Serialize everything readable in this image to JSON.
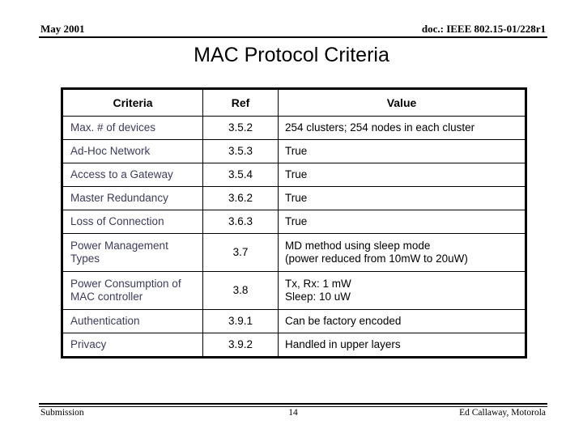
{
  "header": {
    "left": "May 2001",
    "right": "doc.: IEEE 802.15-01/228r1"
  },
  "title": "MAC Protocol Criteria",
  "table": {
    "columns": [
      "Criteria",
      "Ref",
      "Value"
    ],
    "rows": [
      {
        "criteria": "Max. # of devices",
        "ref": "3.5.2",
        "value": "254 clusters; 254 nodes in each cluster",
        "value2": ""
      },
      {
        "criteria": "Ad-Hoc Network",
        "ref": "3.5.3",
        "value": "True",
        "value2": ""
      },
      {
        "criteria": "Access to a Gateway",
        "ref": "3.5.4",
        "value": "True",
        "value2": ""
      },
      {
        "criteria": "Master Redundancy",
        "ref": "3.6.2",
        "value": "True",
        "value2": ""
      },
      {
        "criteria": "Loss of Connection",
        "ref": "3.6.3",
        "value": "True",
        "value2": ""
      },
      {
        "criteria": "Power Management Types",
        "ref": "3.7",
        "value": "MD method using sleep mode",
        "value2": "(power reduced from 10mW to 20uW)"
      },
      {
        "criteria": "Power Consumption of MAC controller",
        "ref": "3.8",
        "value": "Tx, Rx: 1 mW",
        "value2": "Sleep: 10 uW"
      },
      {
        "criteria": "Authentication",
        "ref": "3.9.1",
        "value": "Can be factory encoded",
        "value2": ""
      },
      {
        "criteria": "Privacy",
        "ref": "3.9.2",
        "value": "Handled in upper layers",
        "value2": ""
      }
    ]
  },
  "footer": {
    "left": "Submission",
    "page": "14",
    "right": "Ed Callaway, Motorola"
  },
  "colors": {
    "text": "#000000",
    "criteria_column_text": "#3b3b5e",
    "rule": "#000000",
    "background": "#ffffff"
  }
}
